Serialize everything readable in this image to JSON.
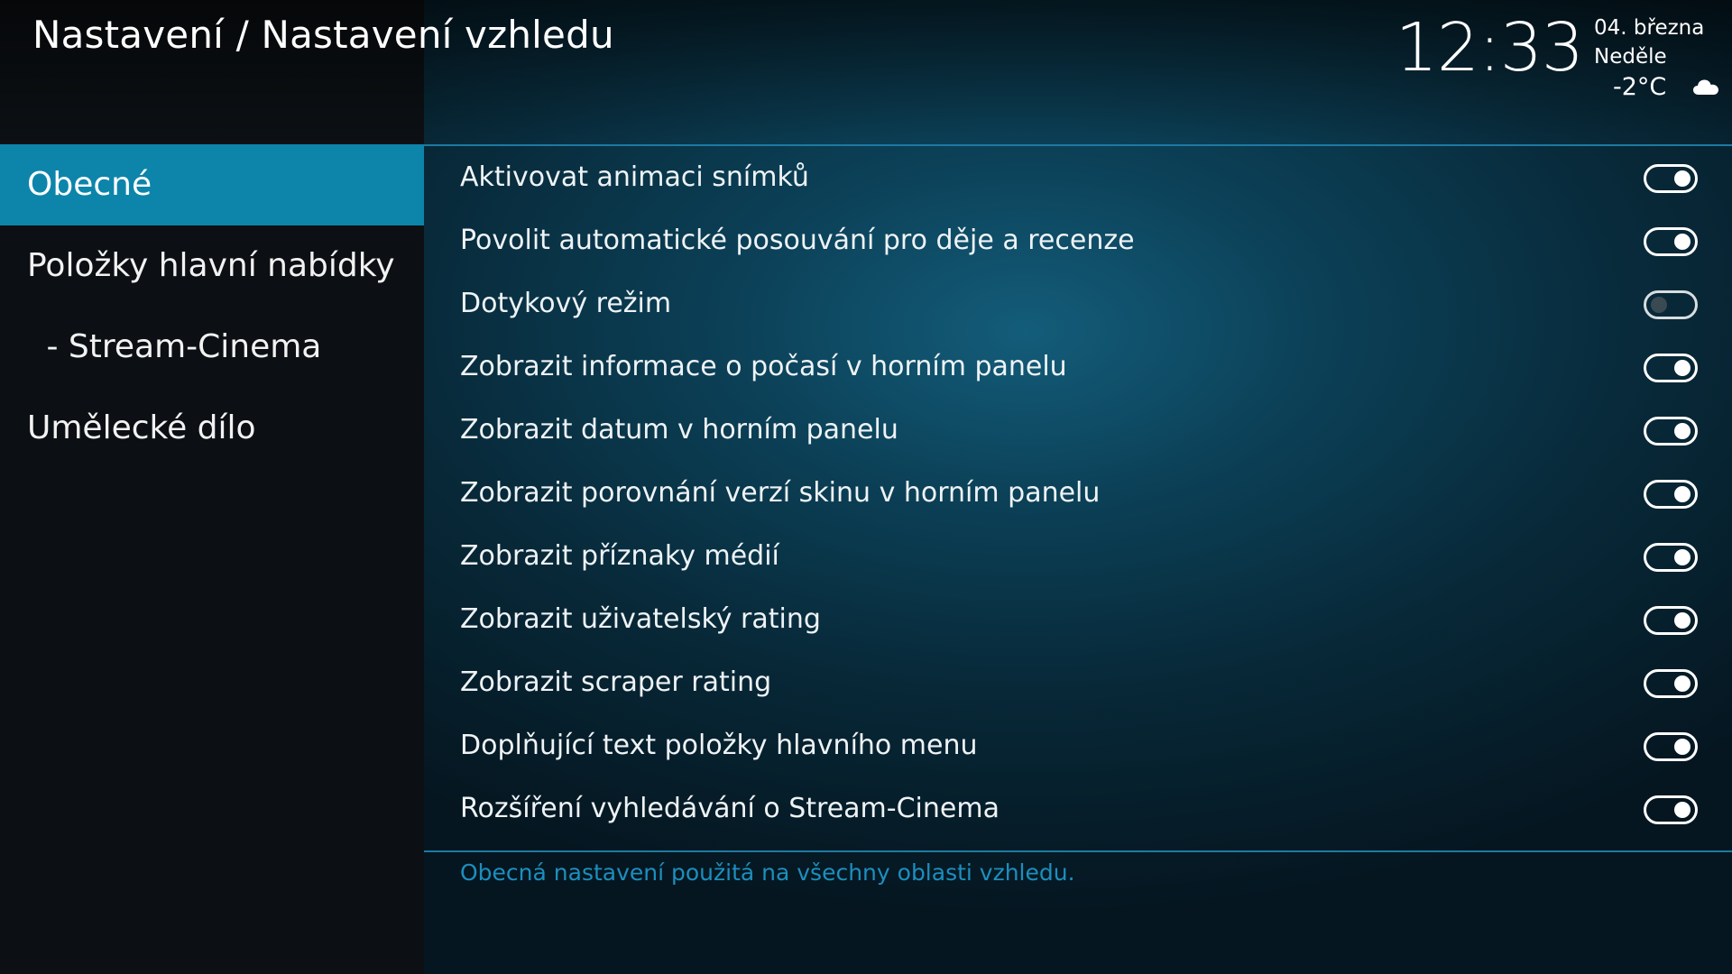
{
  "header": {
    "title": "Nastavení / Nastavení vzhledu",
    "time": "12:33",
    "date": "04. března",
    "day": "Neděle",
    "temperature": "-2°C",
    "weather_icon": "cloud-icon"
  },
  "sidebar": {
    "items": [
      {
        "label": "Obecné",
        "active": true
      },
      {
        "label": "Položky hlavní nabídky",
        "active": false
      },
      {
        "label": " - Stream-Cinema",
        "active": false
      },
      {
        "label": "Umělecké dílo",
        "active": false
      }
    ]
  },
  "settings": [
    {
      "label": "Aktivovat animaci snímků",
      "enabled": true
    },
    {
      "label": "Povolit automatické posouvání pro děje a recenze",
      "enabled": true
    },
    {
      "label": "Dotykový režim",
      "enabled": false
    },
    {
      "label": "Zobrazit informace o počasí v horním panelu",
      "enabled": true
    },
    {
      "label": "Zobrazit datum v horním panelu",
      "enabled": true
    },
    {
      "label": "Zobrazit porovnání verzí skinu v horním panelu",
      "enabled": true
    },
    {
      "label": "Zobrazit příznaky médií",
      "enabled": true
    },
    {
      "label": "Zobrazit uživatelský rating",
      "enabled": true
    },
    {
      "label": "Zobrazit scraper rating",
      "enabled": true
    },
    {
      "label": "Doplňující text položky hlavního menu",
      "enabled": true
    },
    {
      "label": "Rozšíření vyhledávání o Stream-Cinema",
      "enabled": true
    }
  ],
  "description": "Obecná nastavení použitá na všechny oblasti vzhledu.",
  "colors": {
    "accent": "#0d85ab",
    "description_text": "#1c8fbe",
    "divider": "#1d7aa2"
  }
}
